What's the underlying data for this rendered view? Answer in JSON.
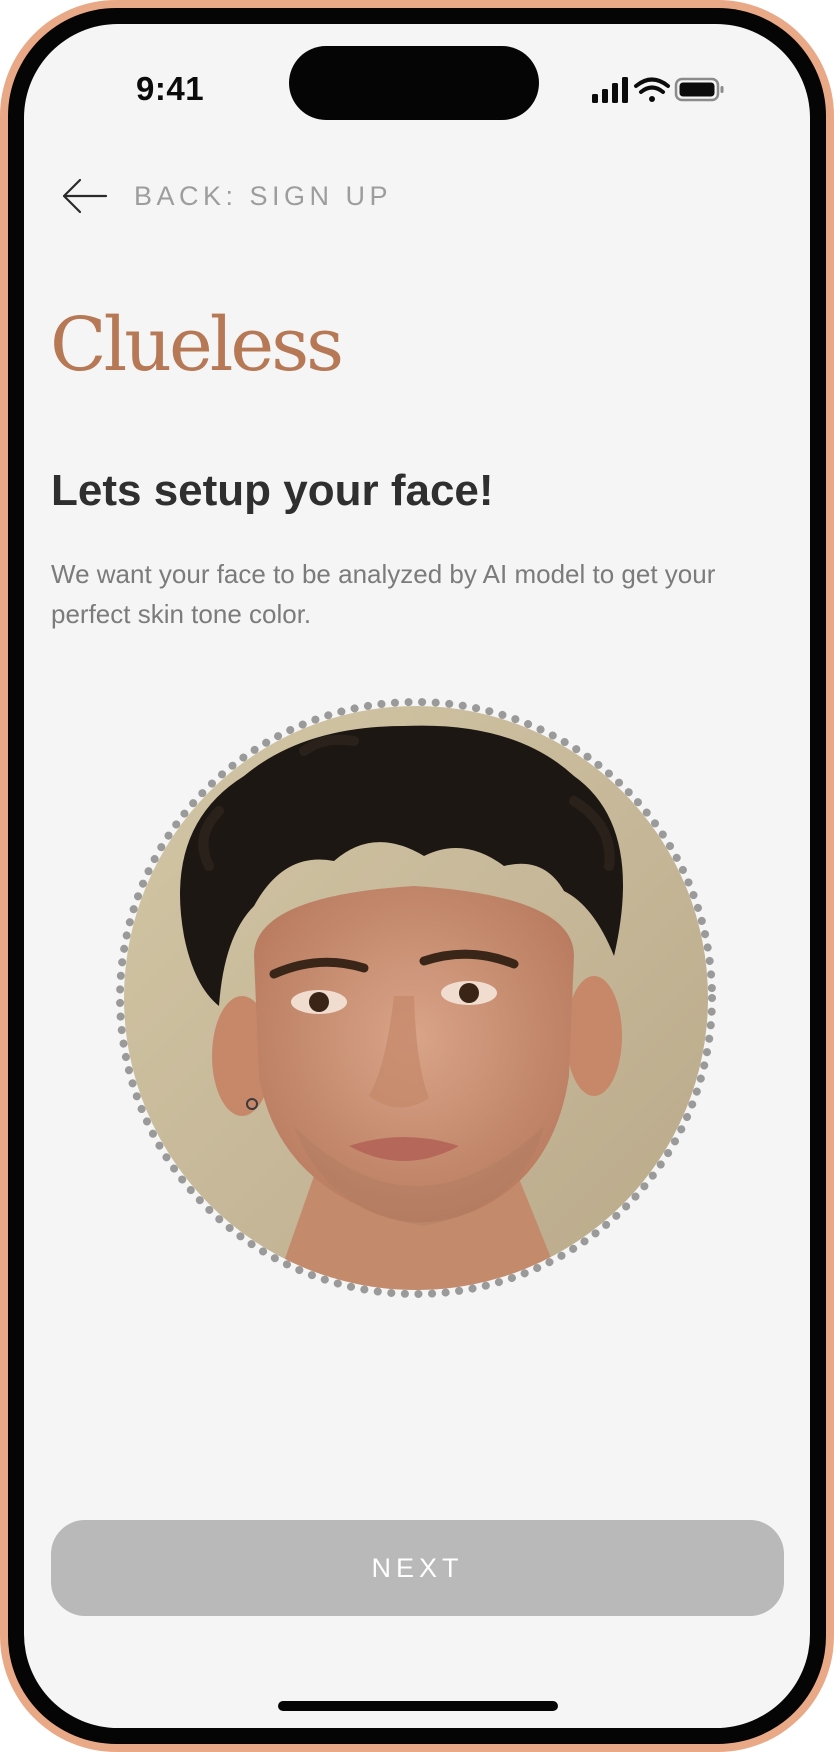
{
  "status_bar": {
    "time": "9:41",
    "icons": [
      "signal-icon",
      "wifi-icon",
      "battery-icon"
    ]
  },
  "nav": {
    "back_label": "BACK: SIGN UP",
    "back_icon": "arrow-left-icon"
  },
  "brand": {
    "name": "Clueless",
    "color": "#b67855"
  },
  "content": {
    "title": "Lets setup your face!",
    "subtitle": "We want your face to be analyzed by AI model to get your perfect skin tone color."
  },
  "face_capture": {
    "image": "face-photo",
    "frame": "dotted-circle"
  },
  "actions": {
    "next_label": "NEXT"
  },
  "colors": {
    "screen_background": "#f5f5f5",
    "button_disabled": "#b9b9b9",
    "frame": "#e9a987"
  }
}
